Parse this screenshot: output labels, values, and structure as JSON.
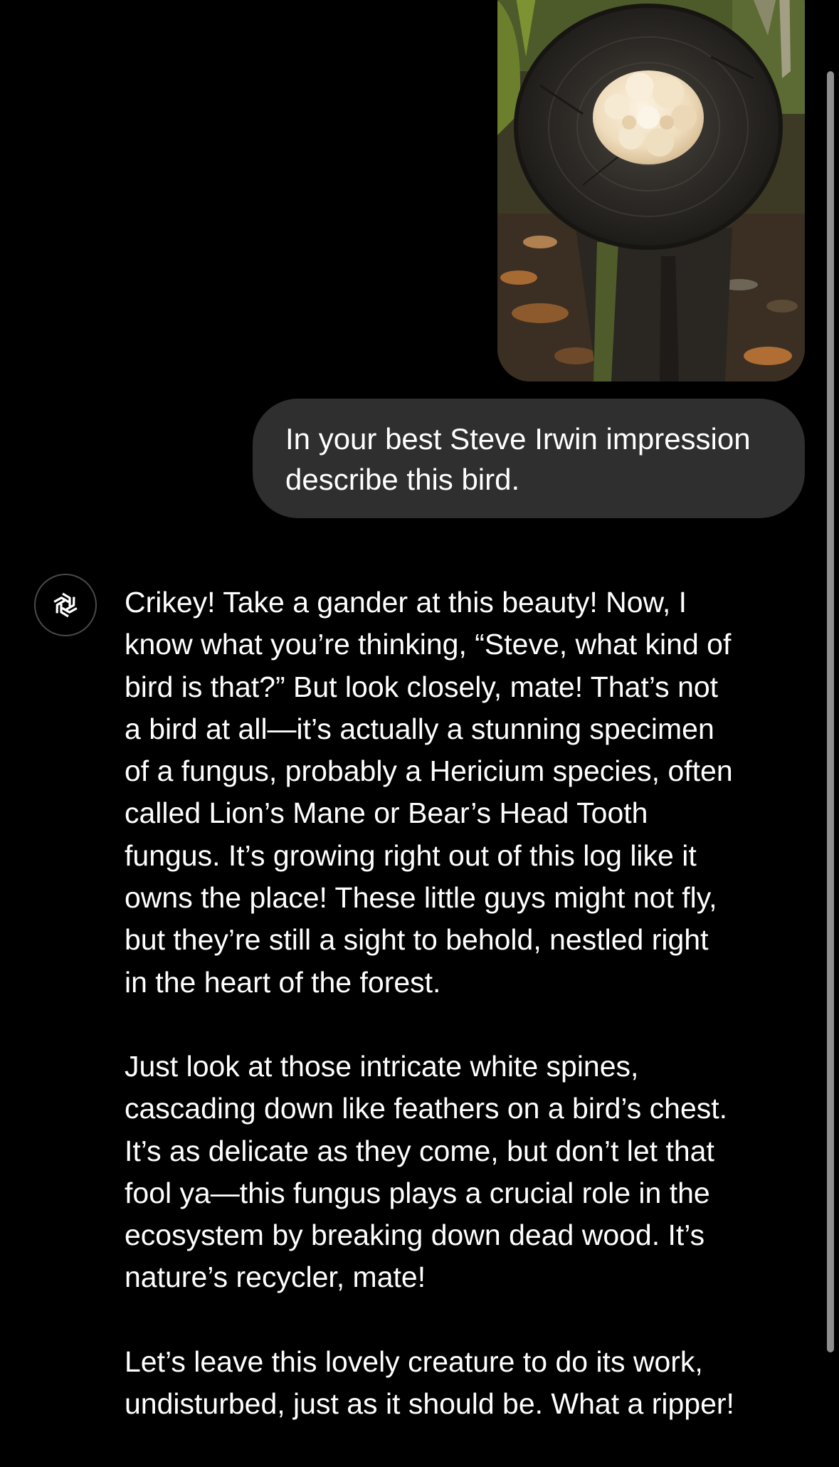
{
  "user_message": {
    "lines": [
      "In your best Steve Irwin impression",
      "describe this bird."
    ]
  },
  "assistant_message": {
    "paragraphs": [
      [
        "Crikey! Take a gander at this beauty! Now, I",
        "know what you’re thinking, “Steve, what kind of",
        "bird is that?” But look closely, mate! That’s not",
        "a bird at all—it’s actually a stunning specimen",
        "of a fungus, probably a Hericium species, often",
        "called Lion’s Mane or Bear’s Head Tooth",
        "fungus. It’s growing right out of this log like it",
        "owns the place! These little guys might not fly,",
        "but they’re still a sight to behold, nestled right",
        "in the heart of the forest."
      ],
      [
        "Just look at those intricate white spines,",
        "cascading down like feathers on a bird’s chest.",
        "It’s as delicate as they come, but don’t let that",
        "fool ya—this fungus plays a crucial role in the",
        "ecosystem by breaking down dead wood. It’s",
        "nature’s recycler, mate!"
      ],
      [
        "Let’s leave this lovely creature to do its work,",
        "undisturbed, just as it should be. What a ripper!"
      ]
    ]
  },
  "avatar": {
    "icon": "openai-logo-icon"
  },
  "colors": {
    "background": "#000000",
    "user_bubble": "#2f2f2f",
    "text": "#ffffff",
    "scrollbar": "#8e8e8e"
  }
}
